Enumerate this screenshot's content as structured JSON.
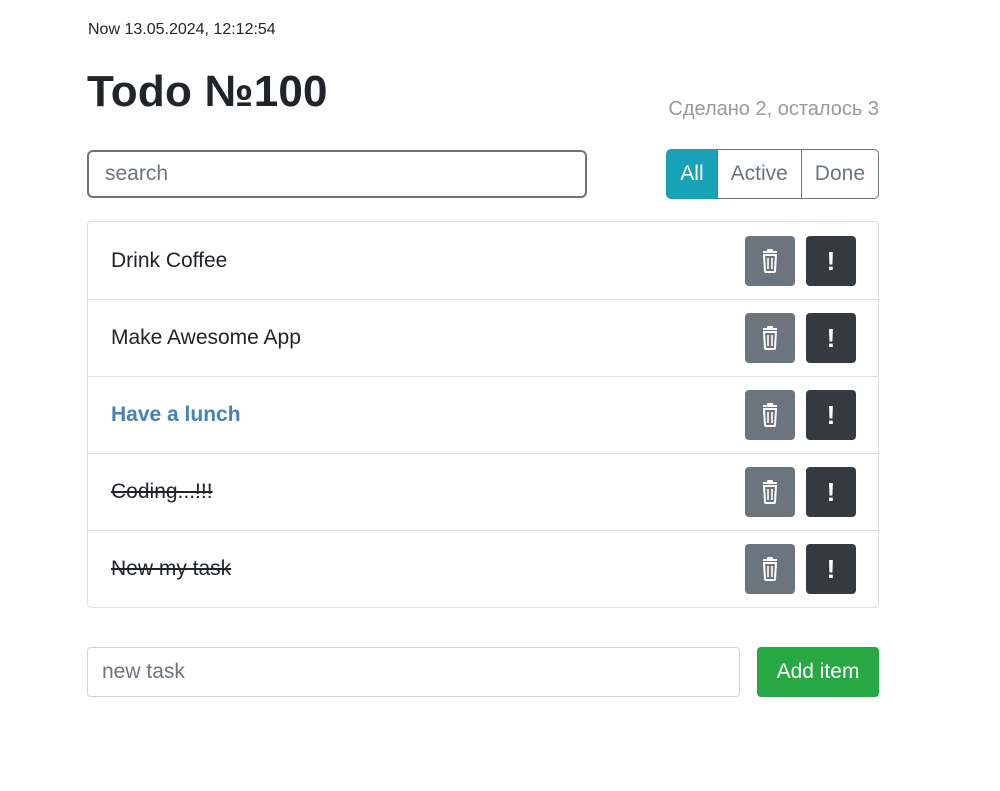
{
  "clock": "Now 13.05.2024, 12:12:54",
  "header": {
    "title": "Todo №100",
    "counter": "Сделано 2, осталось 3"
  },
  "search": {
    "placeholder": "search"
  },
  "filters": [
    {
      "label": "All",
      "active": true
    },
    {
      "label": "Active",
      "active": false
    },
    {
      "label": "Done",
      "active": false
    }
  ],
  "todos": [
    {
      "label": "Drink Coffee",
      "important": false,
      "done": false
    },
    {
      "label": "Make Awesome App",
      "important": false,
      "done": false
    },
    {
      "label": "Have a lunch",
      "important": true,
      "done": false
    },
    {
      "label": "Coding...!!!",
      "important": false,
      "done": true
    },
    {
      "label": "New my task",
      "important": false,
      "done": true
    }
  ],
  "item_actions": {
    "important_glyph": "!",
    "delete_icon": "trash-icon",
    "important_icon": "exclamation-icon"
  },
  "add_form": {
    "placeholder": "new task",
    "button_label": "Add item"
  },
  "colors": {
    "filter_active": "#17a2b8",
    "delete_button": "#6c757d",
    "important_button": "#343a40",
    "add_button": "#28a745",
    "important_text": "#4682b4",
    "counter_text": "#999999"
  }
}
